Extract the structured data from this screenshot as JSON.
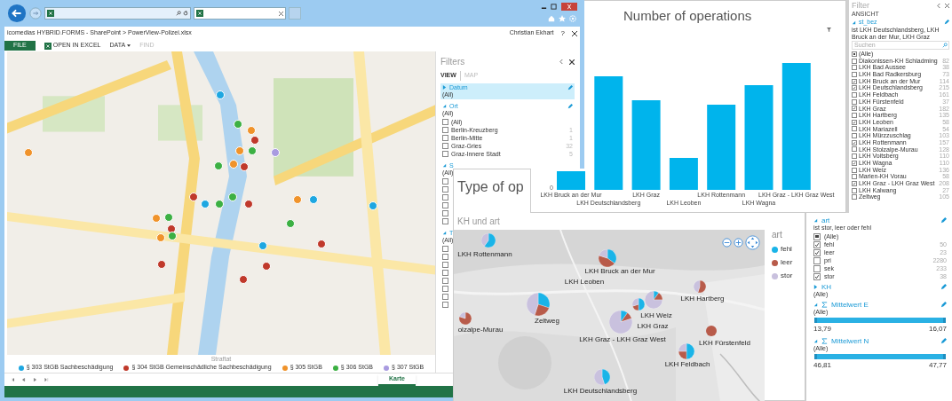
{
  "browser": {
    "breadcrumb": "icomedias HYBRID.FORMS - SharePoint > PowerView-Polizei.xlsx",
    "user": "Christian Ekhart",
    "help": "?",
    "ribbon": [
      {
        "label": "FILE",
        "kind": "file",
        "disabled": false
      },
      {
        "label": "OPEN IN EXCEL",
        "kind": "excel",
        "disabled": false
      },
      {
        "label": "DATA",
        "kind": "menu",
        "disabled": false
      },
      {
        "label": "FIND",
        "kind": "plain",
        "disabled": true
      }
    ],
    "map_legend": {
      "title": "Straftat",
      "items": [
        {
          "label": "§ 303 StGB Sachbeschädigung",
          "color": "#1ea7e1"
        },
        {
          "label": "§ 304 StGB Gemeinschädliche Sachbeschädigung",
          "color": "#c0392b"
        },
        {
          "label": "§ 305 StGB",
          "color": "#f0932b"
        },
        {
          "label": "§ 306 StGB",
          "color": "#3cb043"
        },
        {
          "label": "§ 307 StGB",
          "color": "#a99be0"
        }
      ]
    },
    "sheet_tabs": [
      {
        "label": "Karte",
        "selected": true
      }
    ],
    "filters": {
      "title": "Filters",
      "view_tabs": [
        {
          "label": "VIEW",
          "selected": true
        },
        {
          "label": "MAP",
          "selected": false
        }
      ],
      "sections": [
        {
          "title": "Datum",
          "expanded": false,
          "selected": true,
          "summary": "(All)"
        },
        {
          "title": "Ort",
          "expanded": true,
          "selected": false,
          "summary": "(All)",
          "items": [
            {
              "label": "(All)",
              "checked": false
            },
            {
              "label": "Berlin-Kreuzberg",
              "count": "1",
              "checked": false
            },
            {
              "label": "Berlin-Mitte",
              "count": "1",
              "checked": false
            },
            {
              "label": "Graz-Gries",
              "count": "32",
              "checked": false
            },
            {
              "label": "Graz-Innere Stadt",
              "count": "5",
              "checked": false
            }
          ]
        },
        {
          "title": "S",
          "expanded": true,
          "selected": false,
          "summary": "(All)",
          "items": [
            {
              "checked": false
            },
            {
              "checked": false
            },
            {
              "checked": false
            },
            {
              "checked": false
            },
            {
              "checked": false
            },
            {
              "checked": false
            }
          ]
        },
        {
          "title": "T",
          "expanded": true,
          "selected": false,
          "summary": "(All)",
          "items": [
            {
              "checked": false
            },
            {
              "checked": false
            },
            {
              "checked": false
            },
            {
              "checked": false
            },
            {
              "checked": false
            },
            {
              "checked": false
            },
            {
              "checked": false
            },
            {
              "checked": false
            }
          ]
        }
      ]
    }
  },
  "bar_chart": {
    "title": "Number of operations",
    "zero": "0",
    "categories": [
      "LKH Bruck an der Mur",
      "LKH Deutschlandsberg",
      "LKH Graz",
      "LKH Leoben",
      "LKH Rottenmann",
      "LKH Wagna",
      "LKH Graz - LKH Graz West"
    ]
  },
  "filter_pane": {
    "title": "Filter",
    "view": "ANSICHT",
    "field": "st_bez",
    "summary": "ist LKH Deutschlandsberg, LKH Bruck an der Mur, LKH Graz",
    "search_placeholder": "Suchen",
    "items": [
      {
        "label": "(Alle)",
        "kind": "all",
        "checked": true
      },
      {
        "label": "Diakonissen-KH Schladming",
        "count": "82",
        "kind": "value",
        "checked": false
      },
      {
        "label": "LKH Bad Aussee",
        "count": "38",
        "kind": "value",
        "checked": false
      },
      {
        "label": "LKH Bad Radkersburg",
        "count": "73",
        "kind": "value",
        "checked": false
      },
      {
        "label": "LKH Bruck an der Mur",
        "count": "114",
        "kind": "value",
        "checked": true
      },
      {
        "label": "LKH Deutschlandsberg",
        "count": "215",
        "kind": "value",
        "checked": true
      },
      {
        "label": "LKH Feldbach",
        "count": "161",
        "kind": "value",
        "checked": false
      },
      {
        "label": "LKH Fürstenfeld",
        "count": "37",
        "kind": "value",
        "checked": false
      },
      {
        "label": "LKH Graz",
        "count": "182",
        "kind": "value",
        "checked": true
      },
      {
        "label": "LKH Hartberg",
        "count": "135",
        "kind": "value",
        "checked": false
      },
      {
        "label": "LKH Leoben",
        "count": "58",
        "kind": "value",
        "checked": true
      },
      {
        "label": "LKH Mariazell",
        "count": "54",
        "kind": "value",
        "checked": false
      },
      {
        "label": "LKH Mürzzuschlag",
        "count": "103",
        "kind": "value",
        "checked": false
      },
      {
        "label": "LKH Rottenmann",
        "count": "157",
        "kind": "value",
        "checked": true
      },
      {
        "label": "LKH Stolzalpe-Murau",
        "count": "128",
        "kind": "value",
        "checked": false
      },
      {
        "label": "LKH Voitsberg",
        "count": "110",
        "kind": "value",
        "checked": false
      },
      {
        "label": "LKH Wagna",
        "count": "110",
        "kind": "value",
        "checked": true
      },
      {
        "label": "LKH Weiz",
        "count": "136",
        "kind": "value",
        "checked": false
      },
      {
        "label": "Marien-KH Vorau",
        "count": "58",
        "kind": "value",
        "checked": false
      },
      {
        "label": "LKH Graz - LKH Graz West",
        "count": "208",
        "kind": "value",
        "checked": true
      },
      {
        "label": "LKH Kalwang",
        "count": "27",
        "kind": "value",
        "checked": false
      },
      {
        "label": "Zeltweg",
        "count": "105",
        "kind": "value",
        "checked": false
      }
    ]
  },
  "type_map": {
    "title": "Type of op",
    "subtitle": "KH und art",
    "legend_title": "art",
    "legend": [
      {
        "label": "fehl",
        "color": "#1ab4e8"
      },
      {
        "label": "leer",
        "color": "#b85b4a"
      },
      {
        "label": "stor",
        "color": "#c9c1de"
      }
    ],
    "markers": [
      {
        "label": "LKH Rottenmann"
      },
      {
        "label": "LKH Bruck an der Mur"
      },
      {
        "label": "LKH Leoben"
      },
      {
        "label": "Zeltweg"
      },
      {
        "label": "olzalpe-Murau"
      },
      {
        "label": "LKH Weiz"
      },
      {
        "label": "LKH Hartberg"
      },
      {
        "label": "LKH Graz"
      },
      {
        "label": "LKH Graz - LKH Graz West"
      },
      {
        "label": "LKH Fürstenfeld"
      },
      {
        "label": "LKH Feldbach"
      },
      {
        "label": "LKH Deutschlandsberg"
      }
    ]
  },
  "art_pane": {
    "sections": [
      {
        "title": "art",
        "kind": "list",
        "expanded": true,
        "summary": "ist stor, leer oder fehl",
        "items": [
          {
            "label": "(Alle)",
            "kind": "all",
            "checked": true
          },
          {
            "label": "fehl",
            "count": "50",
            "kind": "value",
            "checked": true
          },
          {
            "label": "leer",
            "count": "23",
            "kind": "value",
            "checked": true
          },
          {
            "label": "pri",
            "count": "2280",
            "kind": "value",
            "checked": false
          },
          {
            "label": "sek",
            "count": "233",
            "kind": "value",
            "checked": false
          },
          {
            "label": "stor",
            "count": "38",
            "kind": "value",
            "checked": true
          }
        ]
      },
      {
        "title": "KH",
        "kind": "list",
        "expanded": false,
        "summary": "(Alle)"
      },
      {
        "title": "Mittelwert E",
        "kind": "range",
        "expanded": true,
        "summary": "(Alle)",
        "level": 1,
        "min": "13,79",
        "max": "16,07"
      },
      {
        "title": "Mittelwert N",
        "kind": "range",
        "expanded": true,
        "summary": "(Alle)",
        "level": 1,
        "min": "46,81",
        "max": "47,77"
      }
    ]
  }
}
